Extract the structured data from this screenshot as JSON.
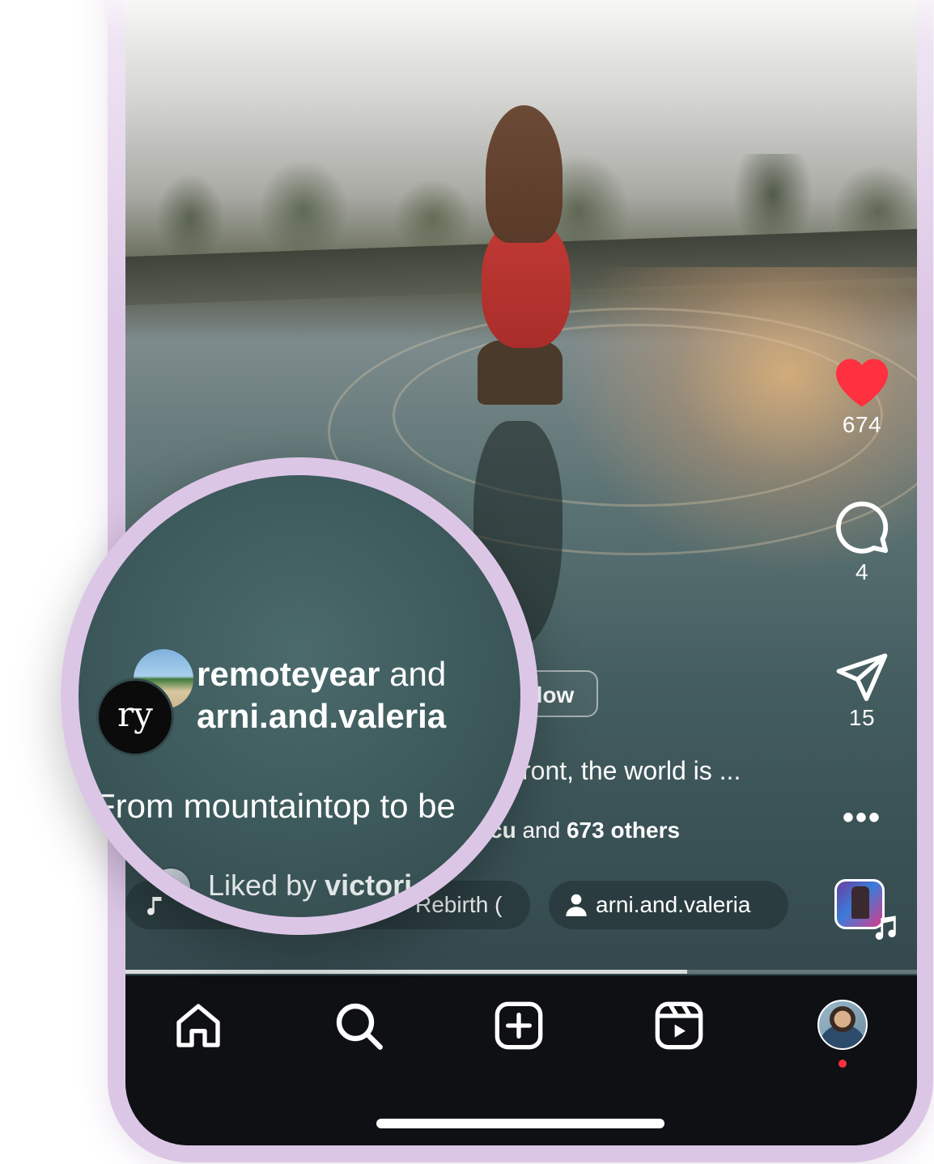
{
  "post": {
    "author_line": "remoteyear and arni.and.valeria",
    "author_primary": "remoteyear",
    "author_conjunction": "and",
    "author_secondary": "arni.and.valeria",
    "follow_label": "low",
    "caption_visible_right": "ront, the world is ...",
    "caption_magnified": "From mountaintop to be",
    "liked_prefix": "Liked by",
    "liked_user_partial": "victori",
    "liked_user_tail": "cu",
    "liked_and": "and",
    "liked_others": "673 others",
    "avatar_monogram": "ry",
    "music_track_partial": "Rebirth (",
    "collaborator_tag": "arni.and.valeria",
    "progress": 0.71
  },
  "actions": {
    "likes": "674",
    "comments": "4",
    "shares": "15",
    "more": "•••"
  },
  "icons": {
    "like": "heart-icon",
    "comment": "comment-icon",
    "share": "paper-plane-icon",
    "music": "music-note-icon",
    "user_tag": "person-icon",
    "home": "home-icon",
    "search": "search-icon",
    "create": "plus-square-icon",
    "reels": "reels-icon"
  },
  "colors": {
    "like_red": "#ff3040",
    "frame": "#dcc6e6",
    "navbar": "#0e1014"
  }
}
